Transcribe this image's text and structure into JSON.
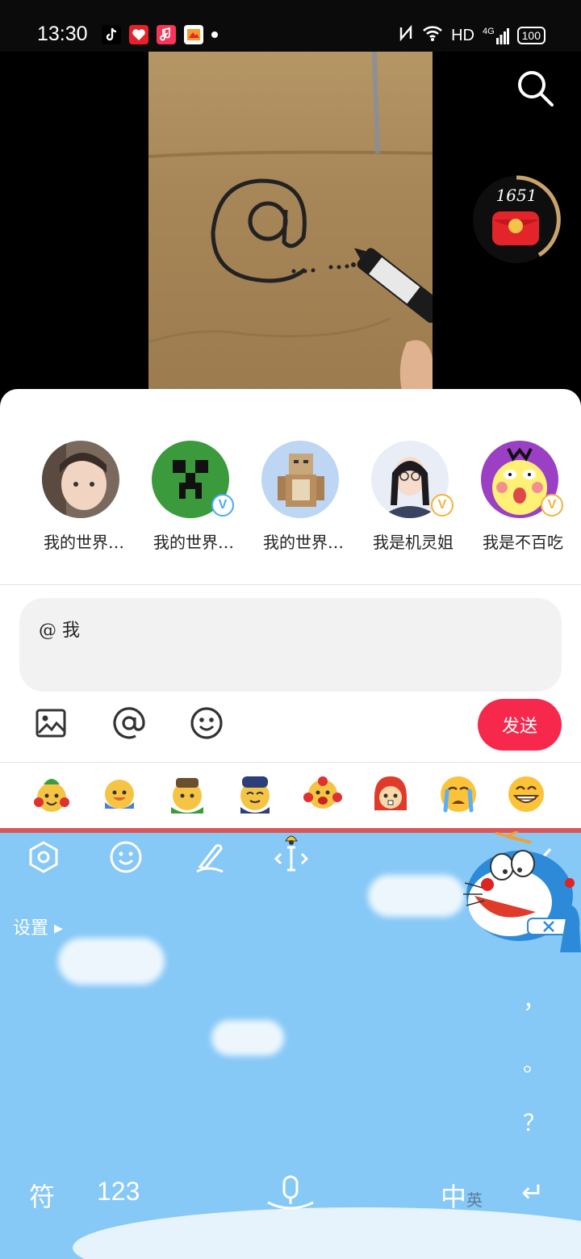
{
  "status_bar": {
    "time": "13:30",
    "network": "HD",
    "signal": "4G",
    "battery": "100"
  },
  "video": {
    "timer_count": "1651"
  },
  "contacts": [
    {
      "name": "我的世界…",
      "verified": false
    },
    {
      "name": "我的世界…",
      "verified": true,
      "badge_color": "#4aa8ff"
    },
    {
      "name": "我的世界…",
      "verified": false
    },
    {
      "name": "我是机灵姐",
      "verified": true,
      "badge_color": "#f3b33c"
    },
    {
      "name": "我是不百吃",
      "verified": true,
      "badge_color": "#f3b33c"
    }
  ],
  "comment": {
    "input_value": "@ 我",
    "send_label": "发送"
  },
  "icons": {
    "image": "image-icon",
    "mention": "at-icon",
    "emoji": "emoji-icon"
  },
  "keyboard": {
    "settings_label": "设置 ▸",
    "punctuation": [
      "，",
      "。",
      "？"
    ],
    "symbols_label": "符",
    "numbers_label": "123",
    "lang_label": "中",
    "lang_alt_label": "英",
    "enter_symbol": "↵"
  },
  "colors": {
    "accent": "#f6284c",
    "keyboard_bg": "#86c8f6"
  }
}
